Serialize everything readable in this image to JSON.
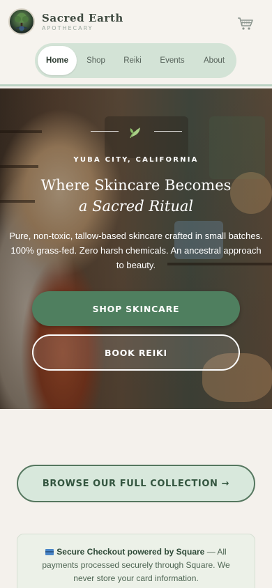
{
  "brand": {
    "name": "Sacred Earth",
    "tagline": "APOTHECARY"
  },
  "header": {
    "cart_icon": "cart-icon"
  },
  "nav": {
    "items": [
      {
        "label": "Home",
        "active": true
      },
      {
        "label": "Shop",
        "active": false
      },
      {
        "label": "Reiki",
        "active": false
      },
      {
        "label": "Events",
        "active": false
      },
      {
        "label": "About",
        "active": false
      }
    ]
  },
  "hero": {
    "icon": "leaf-icon",
    "eyebrow": "YUBA CITY, CALIFORNIA",
    "title_line1": "Where Skincare Becomes",
    "title_line2": "a Sacred Ritual",
    "subtitle": "Pure, non-toxic, tallow-based skincare crafted in small batches. 100% grass-fed. Zero harsh chemicals. An ancestral approach to beauty.",
    "primary_button": "SHOP SKINCARE",
    "secondary_button": "BOOK REIKI"
  },
  "browse": {
    "label": "BROWSE OUR FULL COLLECTION →"
  },
  "secure": {
    "icon": "credit-card-icon",
    "bold_text": "Secure Checkout powered by Square",
    "text": " — All payments processed securely through Square. We never store your card information."
  },
  "colors": {
    "accent_green": "#4f7f5f",
    "nav_bg": "#d3e3d6",
    "page_bg": "#f4f1ec"
  }
}
